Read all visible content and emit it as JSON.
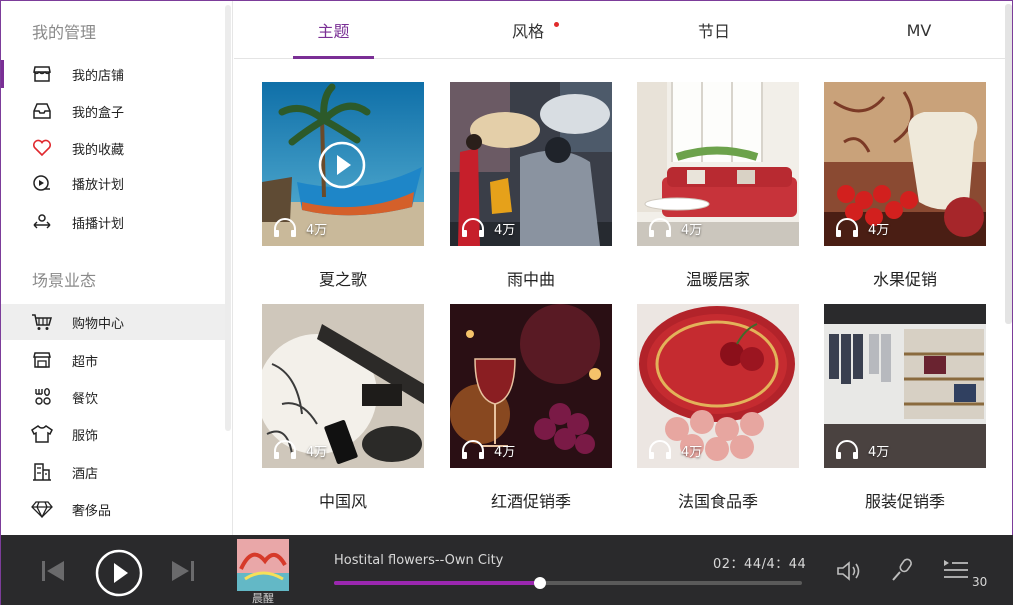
{
  "sidebar": {
    "section1_title": "我的管理",
    "section2_title": "场景业态",
    "items1": [
      {
        "label": "我的店铺",
        "icon": "store-icon"
      },
      {
        "label": "我的盒子",
        "icon": "inbox-icon"
      },
      {
        "label": "我的收藏",
        "icon": "heart-icon"
      },
      {
        "label": "播放计划",
        "icon": "play-schedule-icon"
      },
      {
        "label": "插播计划",
        "icon": "interstitial-icon"
      }
    ],
    "items2": [
      {
        "label": "购物中心",
        "icon": "cart-icon"
      },
      {
        "label": "超市",
        "icon": "supermarket-icon"
      },
      {
        "label": "餐饮",
        "icon": "cutlery-icon"
      },
      {
        "label": "服饰",
        "icon": "shirt-icon"
      },
      {
        "label": "酒店",
        "icon": "hotel-icon"
      },
      {
        "label": "奢侈品",
        "icon": "diamond-icon"
      }
    ]
  },
  "tabs": [
    {
      "label": "主题",
      "active": true
    },
    {
      "label": "风格",
      "badge": true
    },
    {
      "label": "节日"
    },
    {
      "label": "MV"
    }
  ],
  "cards": [
    {
      "title": "夏之歌",
      "count": "4万",
      "has_play": true
    },
    {
      "title": "雨中曲",
      "count": "4万"
    },
    {
      "title": "温暖居家",
      "count": "4万"
    },
    {
      "title": "水果促销",
      "count": "4万"
    },
    {
      "title": "中国风",
      "count": "4万"
    },
    {
      "title": "红酒促销季",
      "count": "4万"
    },
    {
      "title": "法国食品季",
      "count": "4万"
    },
    {
      "title": "服装促销季",
      "count": "4万"
    }
  ],
  "player": {
    "song": "Hostital flowers--Own City",
    "time": "02：44/4：44",
    "album_label": "晨醒",
    "progress": 0.44,
    "queue_count": "30",
    "accent": "#9b27b0"
  }
}
